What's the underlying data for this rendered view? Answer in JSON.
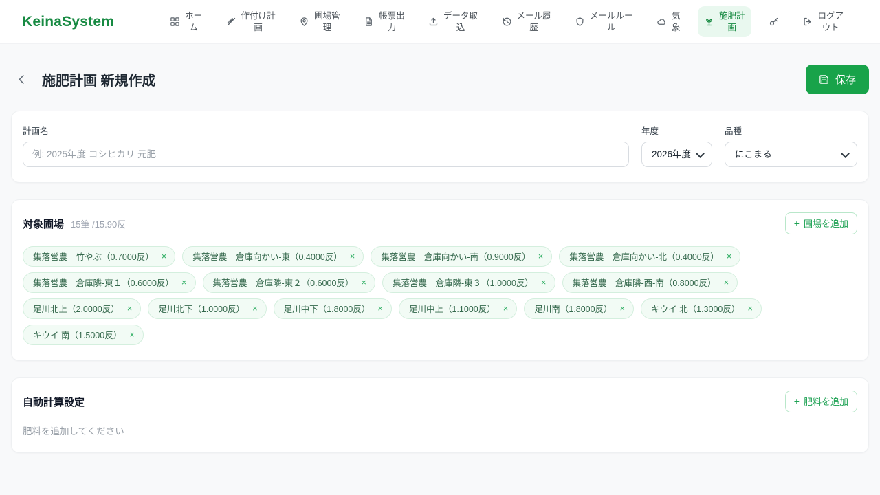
{
  "app": {
    "name": "KeinaSystem"
  },
  "colors": {
    "brand_green": "#178a42",
    "save_button_green": "#18a34a",
    "active_nav_bg": "#e9f8ef",
    "tag_bg": "#f2fbf5",
    "tag_border": "#d4efde",
    "tag_text": "#34684c"
  },
  "nav": {
    "items": [
      {
        "name": "home",
        "icon": "grid-icon",
        "label": "ホー\nム",
        "active": false
      },
      {
        "name": "planting-plan",
        "icon": "wheat-icon",
        "label": "作付け計\n画",
        "active": false
      },
      {
        "name": "field-management",
        "icon": "map-pin-icon",
        "label": "圃場管\n理",
        "active": false
      },
      {
        "name": "report-output",
        "icon": "document-icon",
        "label": "帳票出\n力",
        "active": false
      },
      {
        "name": "data-import",
        "icon": "upload-icon",
        "label": "データ取\n込",
        "active": false
      },
      {
        "name": "mail-history",
        "icon": "history-icon",
        "label": "メール履\n歴",
        "active": false
      },
      {
        "name": "mail-rules",
        "icon": "shield-icon",
        "label": "メールルー\nル",
        "active": false
      },
      {
        "name": "weather",
        "icon": "cloud-icon",
        "label": "気\n象",
        "active": false
      },
      {
        "name": "fertilization-plan",
        "icon": "sprout-icon",
        "label": "施肥計\n画",
        "active": true
      },
      {
        "name": "key",
        "icon": "key-icon",
        "label": "",
        "active": false
      },
      {
        "name": "logout",
        "icon": "logout-icon",
        "label": "ログア\nウト",
        "active": false
      }
    ]
  },
  "page": {
    "title": "施肥計画 新規作成",
    "save_label": "保存"
  },
  "plan_form": {
    "name_label": "計画名",
    "name_placeholder": "例: 2025年度 コシヒカリ 元肥",
    "name_value": "",
    "year_label": "年度",
    "year_value": "2026年度",
    "variety_label": "品種",
    "variety_value": "にこまる"
  },
  "target_fields": {
    "title": "対象圃場",
    "summary": "15筆 /15.90反",
    "add_button_label": "圃場を追加",
    "plus_glyph": "+",
    "remove_glyph": "×",
    "tags": [
      "集落営農　竹やぶ（0.7000反）",
      "集落営農　倉庫向かい-東（0.4000反）",
      "集落営農　倉庫向かい-南（0.9000反）",
      "集落営農　倉庫向かい-北（0.4000反）",
      "集落営農　倉庫隣-東１（0.6000反）",
      "集落営農　倉庫隣-東２（0.6000反）",
      "集落営農　倉庫隣-東３（1.0000反）",
      "集落営農　倉庫隣-西-南（0.8000反）",
      "足川北上（2.0000反）",
      "足川北下（1.0000反）",
      "足川中下（1.8000反）",
      "足川中上（1.1000反）",
      "足川南（1.8000反）",
      "キウイ 北（1.3000反）",
      "キウイ 南（1.5000反）"
    ]
  },
  "auto_calc": {
    "title": "自動計算設定",
    "add_button_label": "肥料を追加",
    "plus_glyph": "+",
    "empty_text": "肥料を追加してください"
  }
}
